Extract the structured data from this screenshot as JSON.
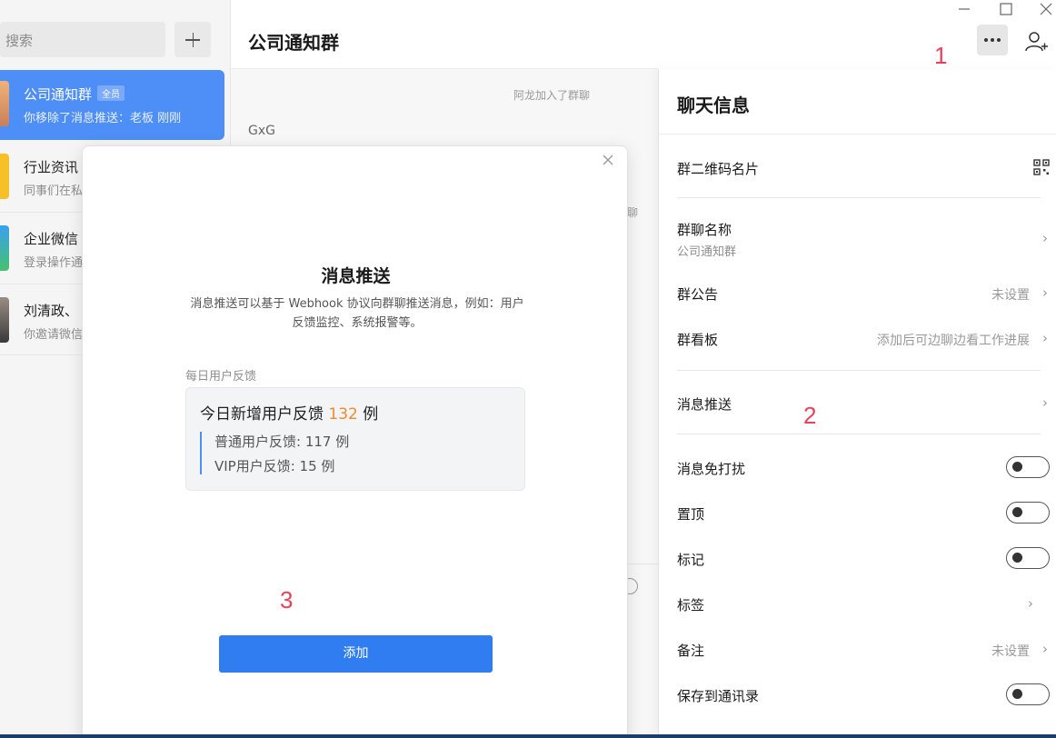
{
  "sidebar": {
    "search_placeholder": "搜索",
    "conversations": [
      {
        "name": "公司通知群",
        "badge": "全员",
        "preview": "你移除了消息推送：老板   刚刚"
      },
      {
        "name": "行业资讯",
        "preview": "同事们在私"
      },
      {
        "name": "企业微信",
        "preview": "登录操作通"
      },
      {
        "name": "刘清政、",
        "preview": "你邀请微信"
      }
    ]
  },
  "chat": {
    "title": "公司通知群",
    "system_message": "阿龙加入了群聊",
    "sender": "GxG",
    "partial_text": "聊"
  },
  "annotations": {
    "one": "1",
    "two": "2",
    "three": "3"
  },
  "panel": {
    "title": "聊天信息",
    "qr_label": "群二维码名片",
    "name_label": "群聊名称",
    "name_value": "公司通知群",
    "notice_label": "群公告",
    "notice_value": "未设置",
    "board_label": "群看板",
    "board_value": "添加后可边聊边看工作进展",
    "push_label": "消息推送",
    "dnd_label": "消息免打扰",
    "pin_label": "置顶",
    "mark_label": "标记",
    "tag_label": "标签",
    "remark_label": "备注",
    "remark_value": "未设置",
    "save_label": "保存到通讯录"
  },
  "modal": {
    "title": "消息推送",
    "description": "消息推送可以基于 Webhook 协议向群聊推送消息，例如：用户反馈监控、系统报警等。",
    "example_label": "每日用户反馈",
    "headline_prefix": "今日新增用户反馈 ",
    "headline_number": "132",
    "headline_suffix": " 例",
    "line1": "普通用户反馈: 117 例",
    "line2": "VIP用户反馈: 15 例",
    "add_button": "添加"
  },
  "colors": {
    "accent": "#2f7df0",
    "active_item": "#4e8ef7",
    "annotation": "#e8415a",
    "highlight": "#f28a2d"
  }
}
